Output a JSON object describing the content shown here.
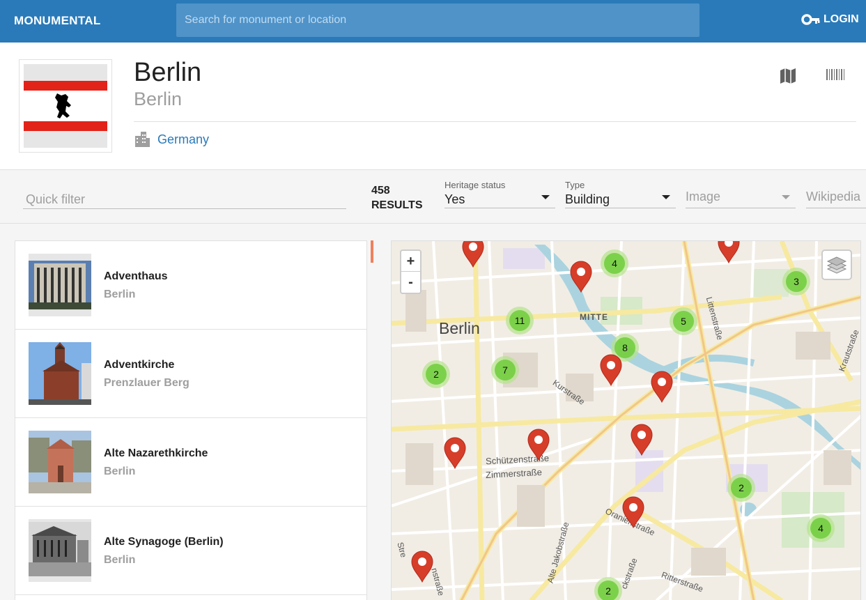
{
  "topbar": {
    "brand": "MONUMENTAL",
    "search_placeholder": "Search for monument or location",
    "login_label": "LOGIN"
  },
  "header": {
    "title": "Berlin",
    "subtitle": "Berlin",
    "country": "Germany",
    "icons": [
      "map-icon",
      "barcode-icon",
      "city-icon"
    ]
  },
  "filters": {
    "quick_filter_placeholder": "Quick filter",
    "results_count": "458",
    "results_label": "RESULTS",
    "heritage_label": "Heritage status",
    "heritage_value": "Yes",
    "type_label": "Type",
    "type_value": "Building",
    "image_placeholder": "Image",
    "wikipedia_placeholder": "Wikipedia"
  },
  "list": {
    "items": [
      {
        "name": "Adventhaus",
        "location": "Berlin"
      },
      {
        "name": "Adventkirche",
        "location": "Prenzlauer Berg"
      },
      {
        "name": "Alte Nazarethkirche",
        "location": "Berlin"
      },
      {
        "name": "Alte Synagoge (Berlin)",
        "location": "Berlin"
      }
    ]
  },
  "map": {
    "zoom_in": "+",
    "zoom_out": "-",
    "labels": {
      "city": "Berlin",
      "district": "MITTE",
      "street1": "Schützenstraße",
      "street2": "Zimmerstraße",
      "street3": "Kurstraße",
      "street4": "Littenstraße",
      "street5": "Krautstraße",
      "street6": "Oranienstraße",
      "street7": "Alte Jakobstraße",
      "street8": "Ritterstraße",
      "street9": "ckstraße",
      "street10": "Stre",
      "street11": "nstraße"
    },
    "clusters": [
      "4",
      "3",
      "11",
      "5",
      "8",
      "2",
      "7",
      "2",
      "4",
      "2"
    ],
    "colors": {
      "cluster_outer": "#b5e28c",
      "cluster_inner": "#6ecc39",
      "pin": "#d63e2a"
    }
  },
  "colors": {
    "primary": "#2a7ab9",
    "accent_scroll": "#f0805a"
  }
}
